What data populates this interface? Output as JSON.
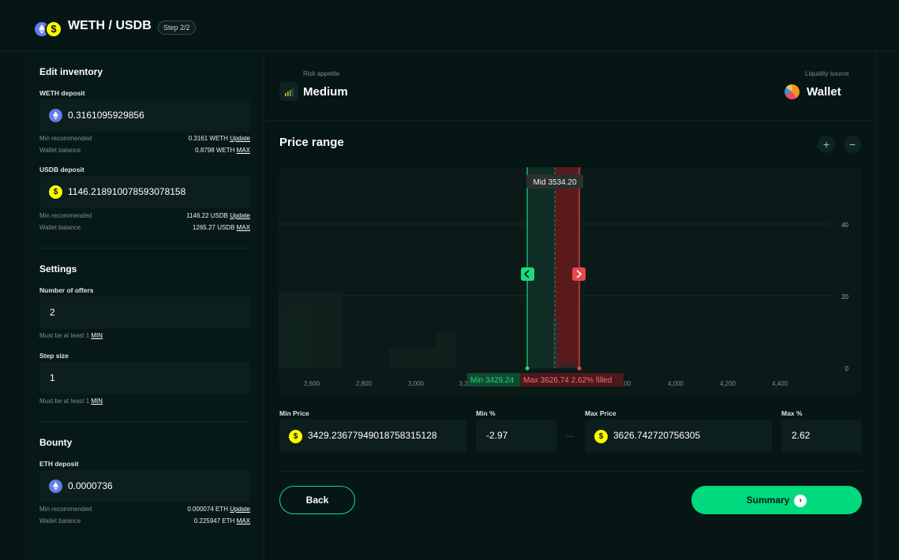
{
  "header": {
    "pair_title": "WETH / USDB",
    "step_badge": "Step 2/2"
  },
  "inventory": {
    "title": "Edit inventory",
    "weth": {
      "label": "WETH deposit",
      "value": "0.3161095929856",
      "min_label": "Min recommended",
      "min_value": "0.3161 WETH",
      "update_label": "Update",
      "balance_label": "Wallet balance",
      "balance_value": "0.8798 WETH",
      "max_label": "MAX"
    },
    "usdb": {
      "label": "USDB deposit",
      "value": "1146.218910078593078158",
      "min_label": "Min recommended",
      "min_value": "1146.22 USDB",
      "update_label": "Update",
      "balance_label": "Wallet balance",
      "balance_value": "1265.27 USDB",
      "max_label": "MAX"
    }
  },
  "settings": {
    "title": "Settings",
    "offers_label": "Number of offers",
    "offers_value": "2",
    "offers_hint": "Must be at least 1",
    "offers_min": "MIN",
    "step_label": "Step size",
    "step_value": "1",
    "step_hint": "Must be at least 1",
    "step_min": "MIN"
  },
  "bounty": {
    "title": "Bounty",
    "label": "ETH deposit",
    "value": "0.0000736",
    "min_label": "Min recommended",
    "min_value": "0.000074 ETH",
    "update_label": "Update",
    "balance_label": "Wallet balance",
    "balance_value": "0.225947 ETH",
    "max_label": "MAX"
  },
  "risk": {
    "label": "Risk appetite",
    "value": "Medium"
  },
  "liquidity": {
    "label": "Liquidity source",
    "value": "Wallet"
  },
  "price_range": {
    "title": "Price range",
    "zoom_in": "+",
    "zoom_out": "−",
    "min_price_label": "Min Price",
    "min_price_value": "3429.236779490187583151​28",
    "min_pct_label": "Min %",
    "min_pct_value": "-2.97",
    "max_price_label": "Max Price",
    "max_price_value": "3626.742720756305",
    "max_pct_label": "Max %",
    "max_pct_value": "2.62",
    "separator": "—"
  },
  "chart_data": {
    "type": "bar",
    "x_ticks": [
      "2,600",
      "2,800",
      "3,000",
      "3,2",
      "",
      "00",
      "4,000",
      "4,200",
      "4,400"
    ],
    "y_ticks": [
      "40",
      "20",
      "0"
    ],
    "mid_label": "Mid 3534.20",
    "min_label": "Min 3429.24",
    "max_label": "Max 3626.74 2.62% filled",
    "xlim": [
      2500,
      4500
    ],
    "ylim": [
      0,
      50
    ],
    "mid": 3534.2,
    "min": 3429.24,
    "max": 3626.74
  },
  "actions": {
    "back": "Back",
    "summary": "Summary",
    "summary_arrow": "›"
  },
  "colors": {
    "accent": "#00d97e",
    "bid": "#1fd97f",
    "ask": "#e5484d",
    "background": "#061614"
  }
}
